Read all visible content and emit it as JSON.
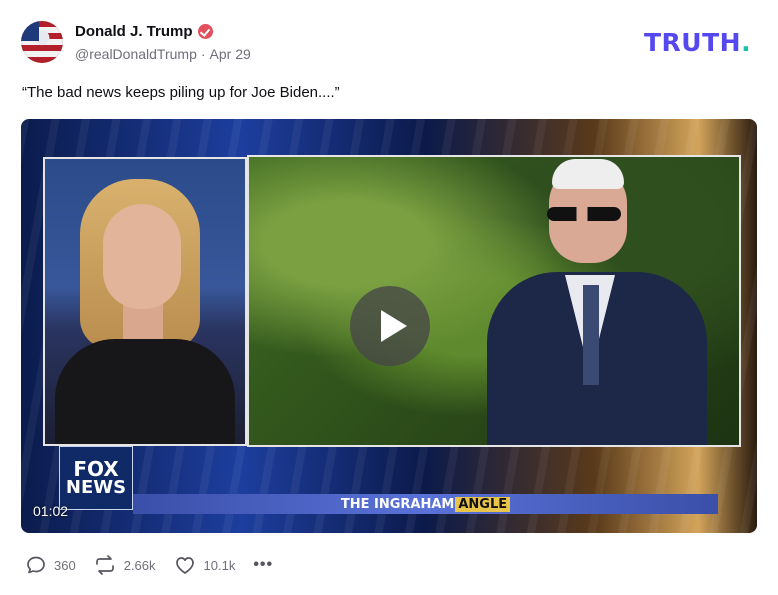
{
  "post": {
    "author_name": "Donald J. Trump",
    "handle": "@realDonaldTrump",
    "separator": "·",
    "date": "Apr 29",
    "text": "“The bad news keeps piling up for Joe Biden....”"
  },
  "brand": {
    "logo_text": "TRUTH",
    "logo_dot": ".",
    "primary_color": "#5448ee",
    "dot_color": "#16c3a9"
  },
  "media": {
    "duration": "01:02",
    "network_line1": "FOX",
    "network_line2": "NEWS",
    "show_title": "THE INGRAHAM",
    "show_accent": "ANGLE"
  },
  "actions": {
    "replies": "360",
    "retruths": "2.66k",
    "likes": "10.1k",
    "more": "•••"
  },
  "icons": [
    "verified-icon",
    "reply-icon",
    "retruth-icon",
    "like-icon",
    "more-icon",
    "play-icon"
  ]
}
